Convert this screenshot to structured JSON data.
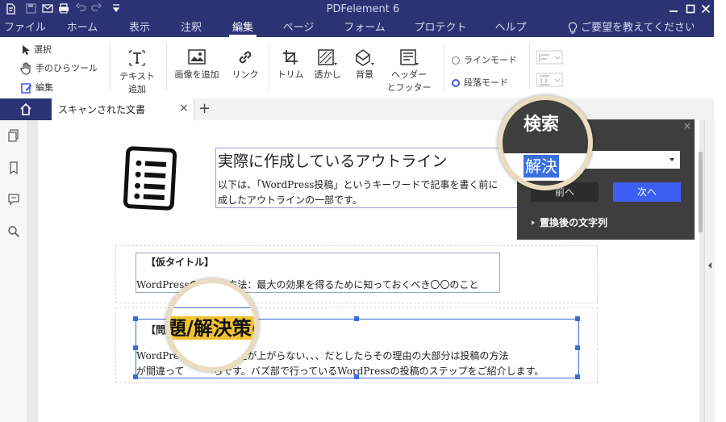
{
  "app": {
    "title": "PDFelement 6",
    "window_controls": [
      "minimize-icon",
      "maximize-icon",
      "close-icon"
    ],
    "quick_access": [
      "logo-icon",
      "save-icon",
      "email-icon",
      "print-icon",
      "undo-icon",
      "redo-icon",
      "customize-icon"
    ]
  },
  "menu": {
    "items": [
      "ファイル",
      "ホーム",
      "表示",
      "注釈",
      "編集",
      "ページ",
      "フォーム",
      "プロテクト",
      "ヘルプ"
    ],
    "active": "編集",
    "help_prompt": "ご要望を教えてください..."
  },
  "ribbon": {
    "tools": [
      "選択",
      "手のひらツール",
      "編集"
    ],
    "text_add": [
      "テキスト",
      "追加"
    ],
    "image_add": "画像を追加",
    "link": "リンク",
    "trim": "トリム",
    "watermark": "透かし",
    "background": "背景",
    "header_footer": [
      "ヘッダー",
      "とフッター"
    ],
    "mode_line": "ラインモード",
    "mode_paragraph": "段落モード",
    "selected_mode": "段落モード"
  },
  "tabs": {
    "home_icon": "home-icon",
    "document": "スキャンされた文書",
    "close": "×",
    "add": "+"
  },
  "document": {
    "heading": "実際に作成しているアウトライン",
    "intro_line1": "以下は、「WordPress投稿」というキーワードで記事を書く前に",
    "intro_line2": "成したアウトラインの一部です。",
    "block1_title": "【仮タイトル】",
    "block1_text": "WordPressの　　　方法：最大の効果を得るために知っておくべき〇〇のこと",
    "block2_title": "【問題/解決策の根拠】",
    "block2_line1": "WordPress　　　索順位が上がらない、、、だとしたらその理由の大部分は投稿の方法",
    "block2_line2": "が間違って　　　らです。バズ部で行っているWordPressの投稿のステップをご紹介します。",
    "magnifier_text": "題/解決策の"
  },
  "search_panel": {
    "title": "検索",
    "query": "解決",
    "prev": "前へ",
    "next": "次へ",
    "replace_label": "置換後の文字列",
    "close": "×"
  },
  "colors": {
    "titlebar": "#2b3374",
    "accent_button": "#3d5ef0",
    "panel": "#3e3e3e",
    "highlight": "#f1c232",
    "selection": "#3b6fd6"
  }
}
